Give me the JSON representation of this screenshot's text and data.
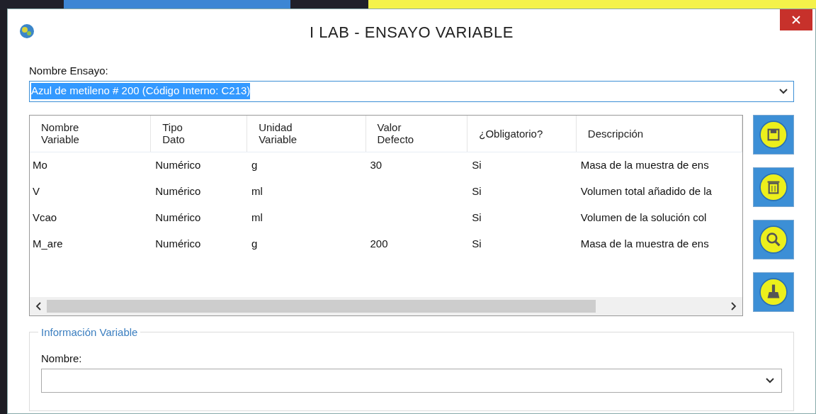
{
  "window": {
    "title": "I LAB - ENSAYO VARIABLE"
  },
  "ensayo": {
    "label": "Nombre Ensayo:",
    "value": "Azul de metileno # 200 (Código Interno: C213)",
    "text_selected": true
  },
  "table": {
    "columns": [
      "Nombre\nVariable",
      "Tipo\nDato",
      "Unidad\nVariable",
      "Valor\nDefecto",
      "¿Obligatorio?",
      "Descripción"
    ],
    "rows": [
      [
        "Mo",
        "Numérico",
        "g",
        "30",
        "Si",
        "Masa de la muestra de ens"
      ],
      [
        "V",
        "Numérico",
        "ml",
        "",
        "Si",
        "Volumen total añadido de la"
      ],
      [
        "Vcao",
        "Numérico",
        "ml",
        "",
        "Si",
        "Volumen de la solución col"
      ],
      [
        "M_are",
        "Numérico",
        "g",
        "200",
        "Si",
        "Masa de la muestra de ens"
      ]
    ]
  },
  "side_buttons": [
    {
      "kind": "save"
    },
    {
      "kind": "delete"
    },
    {
      "kind": "search"
    },
    {
      "kind": "clear"
    }
  ],
  "group": {
    "title": "Información Variable",
    "label": "Nombre:"
  }
}
